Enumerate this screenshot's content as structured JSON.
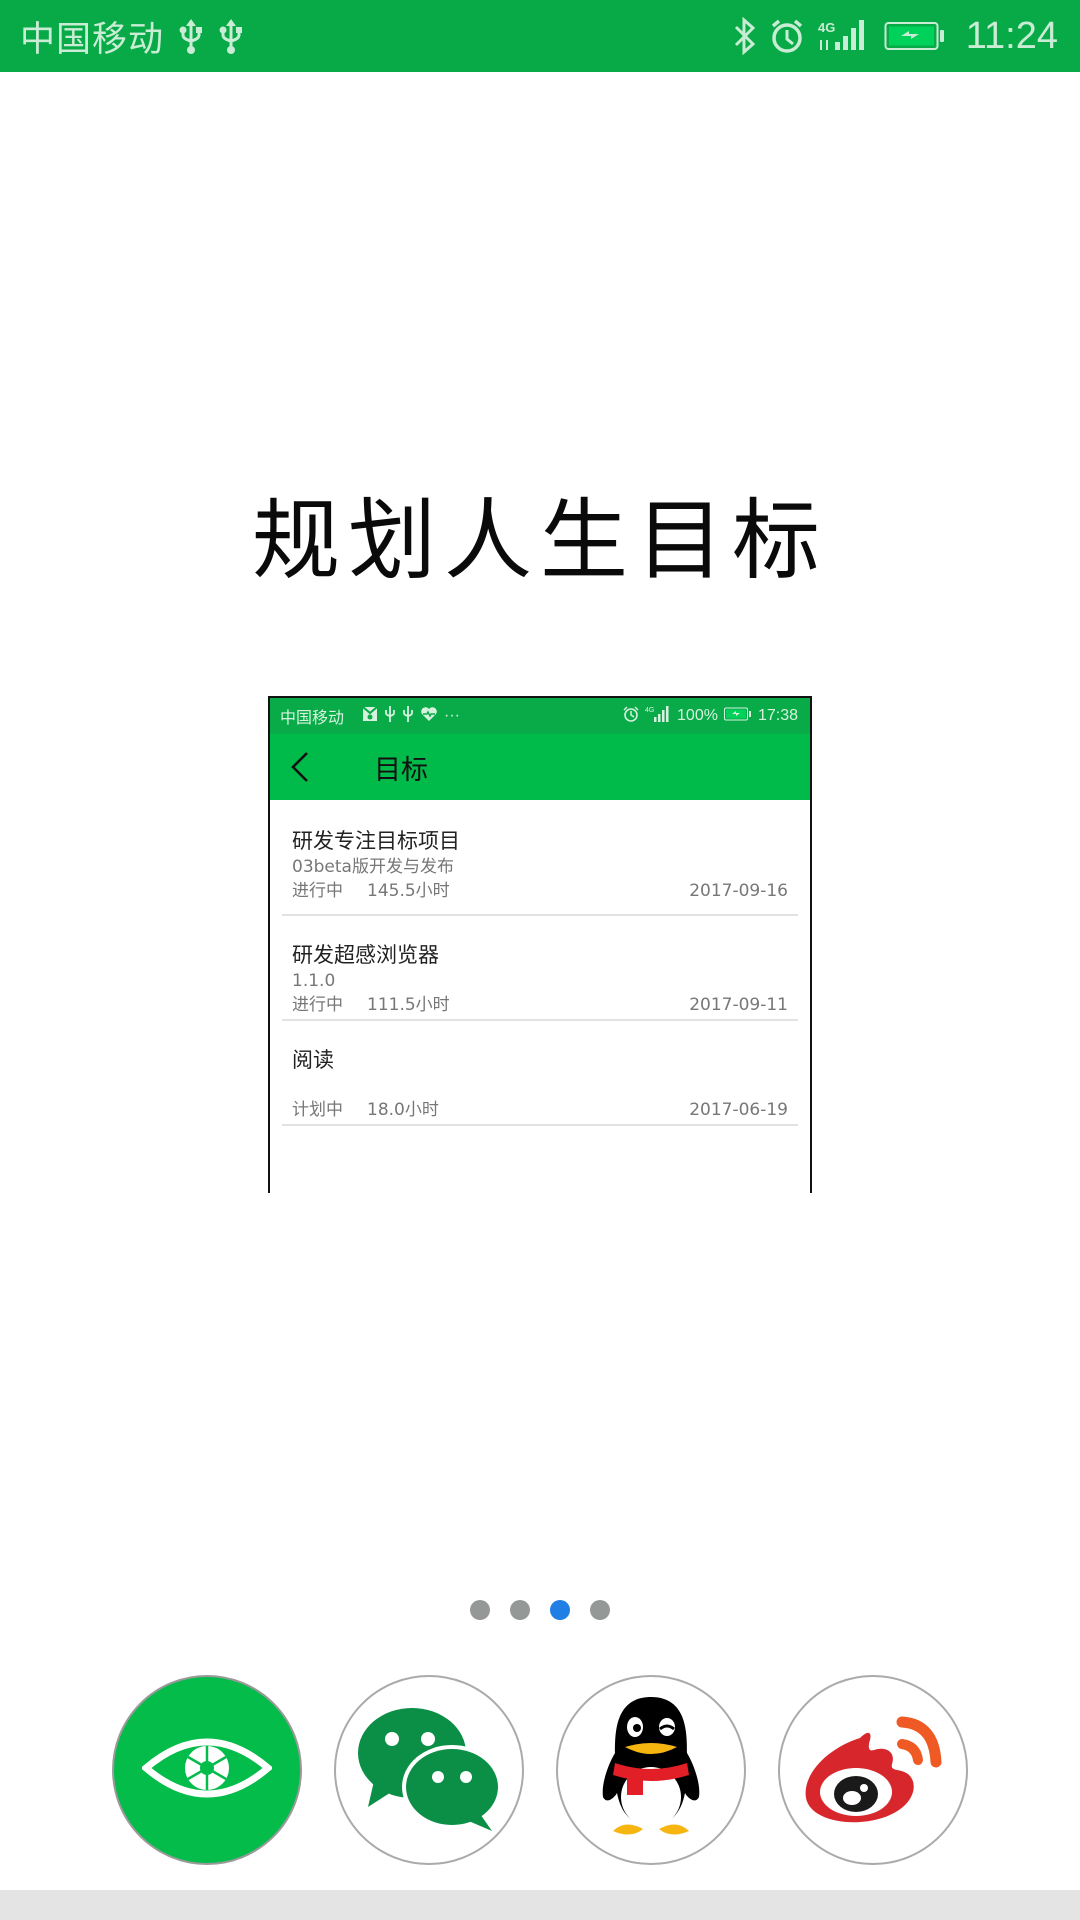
{
  "status_bar": {
    "carrier": "中国移动",
    "left_icons": [
      "usb-icon",
      "usb-icon"
    ],
    "right_icons": [
      "bluetooth-icon",
      "alarm-icon",
      "signal-4g-icon",
      "battery-charging-icon"
    ],
    "network": "4G",
    "time": "11:24"
  },
  "headline": "规划人生目标",
  "preview": {
    "status_bar": {
      "carrier": "中国移动",
      "left_icons": [
        "notification-icon",
        "usb-icon",
        "usb-icon",
        "health-icon",
        "more-icon"
      ],
      "more": "···",
      "network": "4G",
      "battery": "100%",
      "time": "17:38"
    },
    "app_bar": {
      "back_icon": "back-arrow-icon",
      "title": "目标"
    },
    "goals": [
      {
        "name": "研发专注目标项目",
        "subtitle": "03beta版开发与发布",
        "status": "进行中",
        "hours": "145.5小时",
        "date": "2017-09-16"
      },
      {
        "name": "研发超感浏览器",
        "subtitle": "1.1.0",
        "status": "进行中",
        "hours": "111.5小时",
        "date": "2017-09-11"
      },
      {
        "name": "阅读",
        "subtitle": "",
        "status": "计划中",
        "hours": "18.0小时",
        "date": "2017-06-19"
      }
    ]
  },
  "pager": {
    "count": 4,
    "active_index": 2,
    "active_color": "#1f7fe5",
    "inactive_color": "#949998"
  },
  "share_buttons": [
    {
      "id": "app",
      "icon": "eye-aperture-icon",
      "color": "#04bc4a"
    },
    {
      "id": "wechat",
      "icon": "wechat-icon",
      "color": "#0b8f47"
    },
    {
      "id": "qq",
      "icon": "qq-penguin-icon",
      "color": "#000000"
    },
    {
      "id": "weibo",
      "icon": "weibo-icon",
      "color": "#d8262d"
    }
  ],
  "colors": {
    "status_bar": "#07aa46",
    "app_bar": "#00bb49"
  }
}
